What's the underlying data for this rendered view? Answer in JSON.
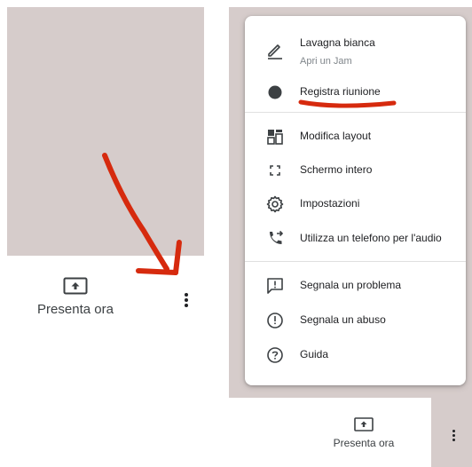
{
  "left": {
    "present_label": "Presenta ora",
    "present_icon": "present-screen-icon",
    "more_icon": "more-vert-icon"
  },
  "menu": {
    "items": [
      {
        "label": "Lavagna bianca",
        "sub": "Apri un Jam",
        "icon": "pencil-icon"
      },
      {
        "label": "Registra riunione",
        "icon": "record-icon"
      },
      {
        "label": "Modifica layout",
        "icon": "layout-icon"
      },
      {
        "label": "Schermo intero",
        "icon": "fullscreen-icon"
      },
      {
        "label": "Impostazioni",
        "icon": "gear-icon"
      },
      {
        "label": "Utilizza un telefono per l'audio",
        "icon": "phone-forward-icon"
      },
      {
        "label": "Segnala un problema",
        "icon": "feedback-icon"
      },
      {
        "label": "Segnala un abuso",
        "icon": "alert-circle-icon"
      },
      {
        "label": "Guida",
        "icon": "help-icon"
      }
    ]
  },
  "bottom_right": {
    "present_label": "Presenta ora"
  },
  "annotation": {
    "arrow_color": "#d62a0e",
    "underline_color": "#d62a0e"
  }
}
